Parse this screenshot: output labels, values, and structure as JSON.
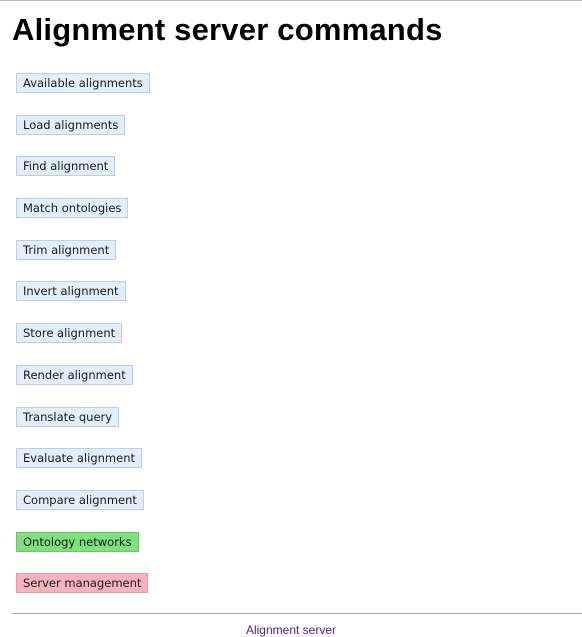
{
  "page": {
    "title": "Alignment server commands"
  },
  "commands": [
    {
      "label": "Available alignments",
      "color": "#e2eefb"
    },
    {
      "label": "Load alignments",
      "color": "#e2eefb"
    },
    {
      "label": "Find alignment",
      "color": "#e2eefb"
    },
    {
      "label": "Match ontologies",
      "color": "#e2eefb"
    },
    {
      "label": "Trim alignment",
      "color": "#e2eefb"
    },
    {
      "label": "Invert alignment",
      "color": "#e2eefb"
    },
    {
      "label": "Store alignment",
      "color": "#e2eefb"
    },
    {
      "label": "Render alignment",
      "color": "#e2eefb"
    },
    {
      "label": "Translate query",
      "color": "#e2eefb"
    },
    {
      "label": "Evaluate alignment",
      "color": "#e2eefb"
    },
    {
      "label": "Compare alignment",
      "color": "#e2eefb"
    },
    {
      "label": "Ontology networks",
      "color": "#7ee17e"
    },
    {
      "label": "Server management",
      "color": "#f7b3bd"
    }
  ],
  "footer": {
    "link_text": "Alignment server",
    "link_color": "#551a8b"
  }
}
